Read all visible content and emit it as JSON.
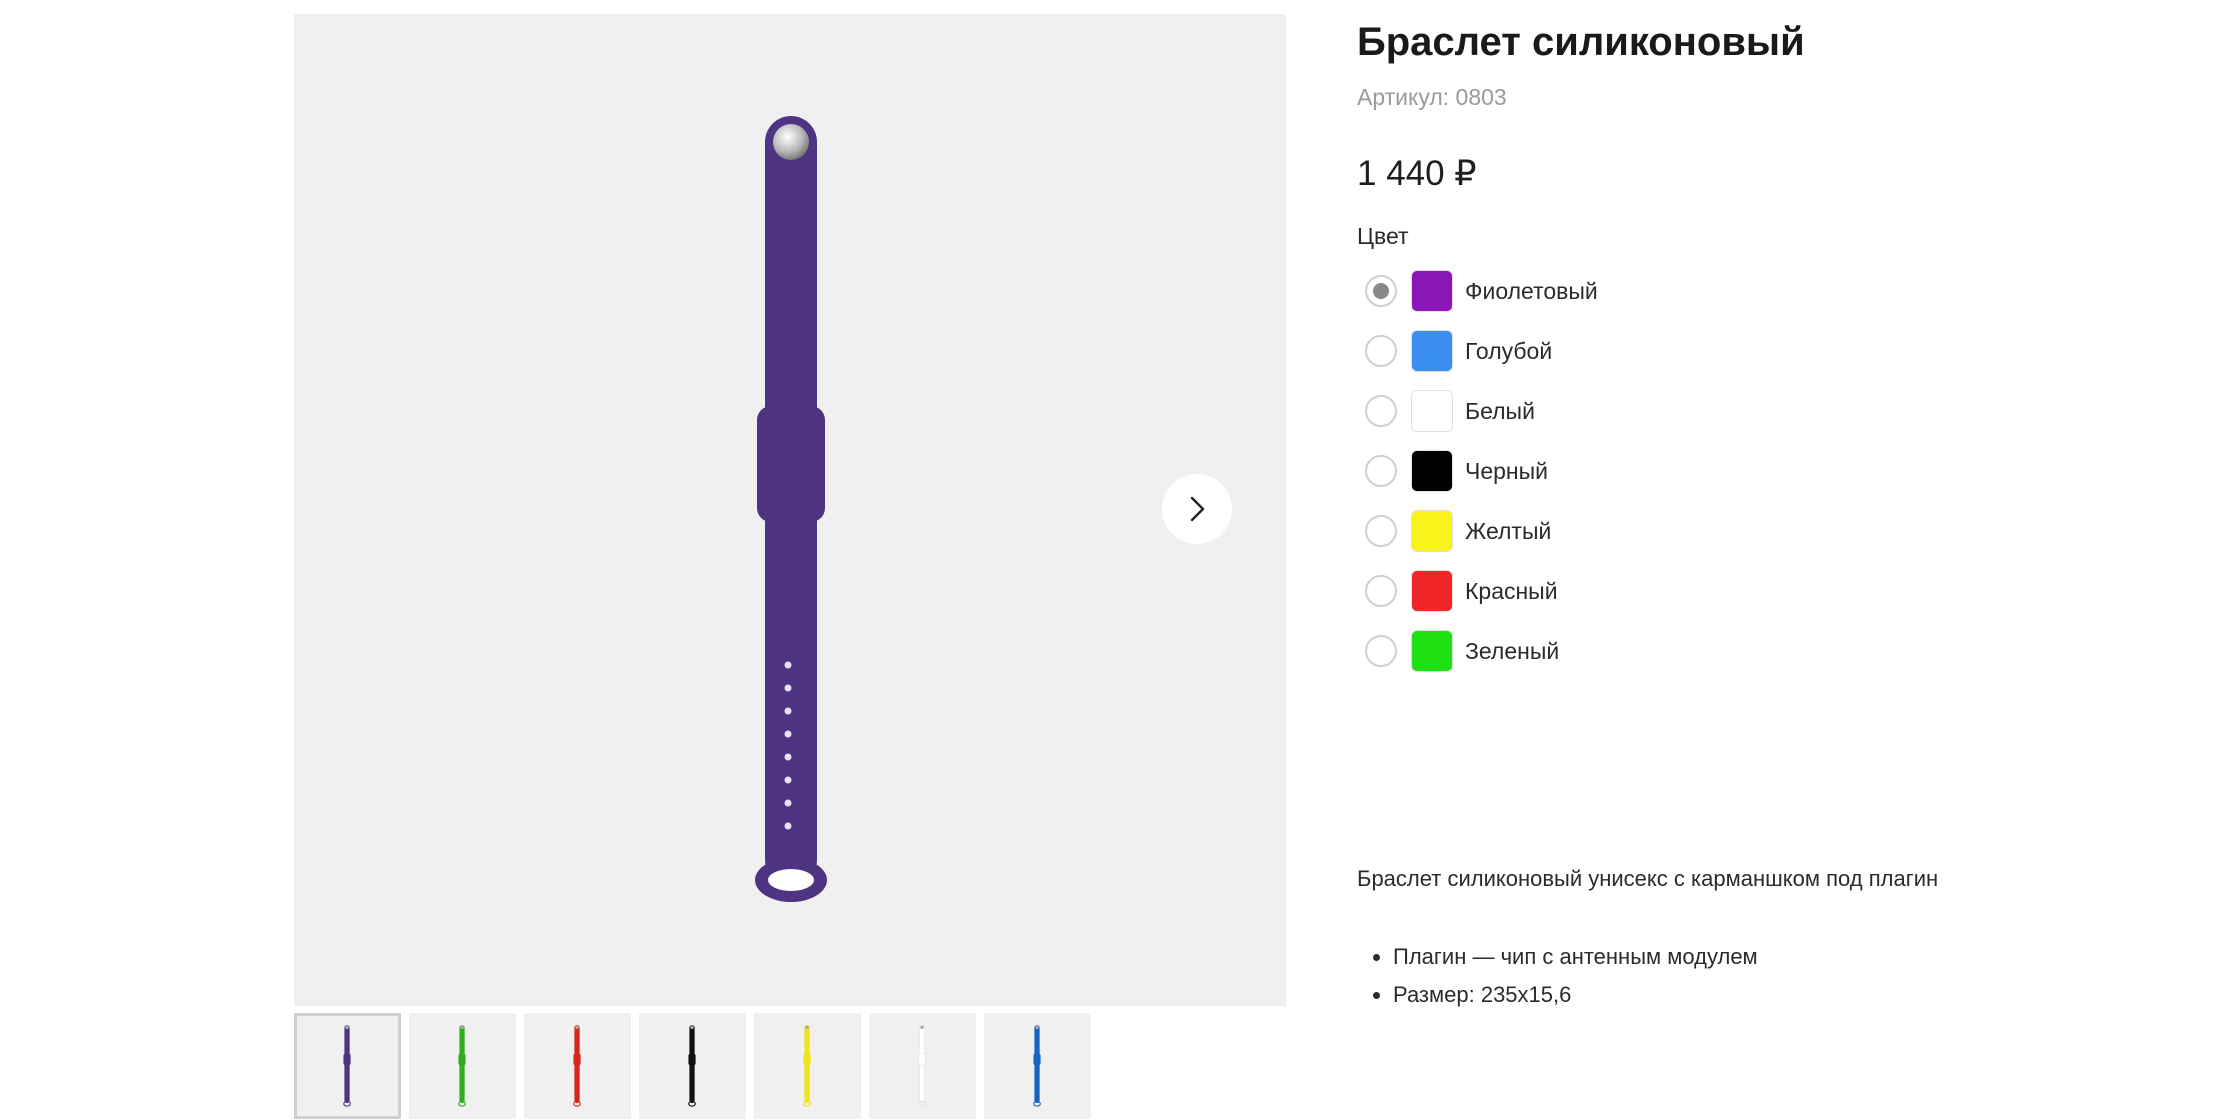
{
  "product": {
    "title": "Браслет силиконовый",
    "sku": "Артикул: 0803",
    "price": "1 440 ₽",
    "color_label": "Цвет",
    "description": "Браслет силиконовый унисекс с карманшком под плагин",
    "features": [
      "Плагин — чип с антенным модулем",
      "Размер: 235х15,6"
    ]
  },
  "gallery": {
    "main_color": "#4e3482",
    "next_icon": "chevron-right-icon",
    "thumbnails": [
      {
        "color": "#4e3482",
        "active": true
      },
      {
        "color": "#2fae1e",
        "active": false
      },
      {
        "color": "#d8251b",
        "active": false
      },
      {
        "color": "#111111",
        "active": false
      },
      {
        "color": "#f2e21a",
        "active": false
      },
      {
        "color": "#ffffff",
        "active": false
      },
      {
        "color": "#1565c0",
        "active": false
      }
    ]
  },
  "colors": [
    {
      "name": "Фиолетовый",
      "hex": "#8a17b8",
      "selected": true
    },
    {
      "name": "Голубой",
      "hex": "#3d8ef2",
      "selected": false
    },
    {
      "name": "Белый",
      "hex": "#ffffff",
      "selected": false
    },
    {
      "name": "Черный",
      "hex": "#000000",
      "selected": false
    },
    {
      "name": "Желтый",
      "hex": "#fbf21c",
      "selected": false
    },
    {
      "name": "Красный",
      "hex": "#f42528",
      "selected": false
    },
    {
      "name": "Зеленый",
      "hex": "#1fe010",
      "selected": false
    }
  ]
}
